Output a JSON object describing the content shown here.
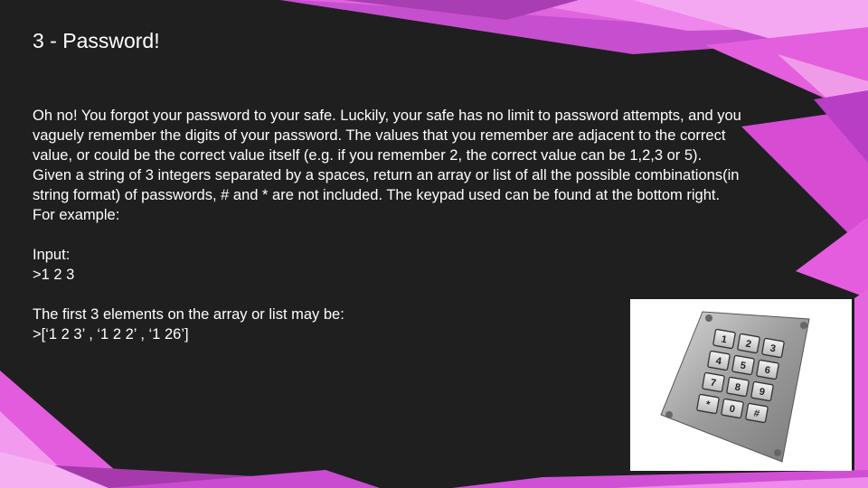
{
  "slide": {
    "title": "3 - Password!",
    "paragraphs": [
      "Oh no! You forgot your password to your safe. Luckily, your safe has no limit to password attempts, and you vaguely remember the digits of your password. The values that you remember are adjacent to the correct value, or could be the correct value itself (e.g. if you remember 2, the correct value can be 1,2,3 or 5).",
      "Given a string of 3 integers separated by a spaces, return an array or list of all the possible combinations(in string format) of passwords, # and * are not included. The keypad used can be found at the bottom right.",
      "For example:"
    ],
    "input_label": "Input:",
    "input_value": ">1 2 3",
    "output_label": "The first 3 elements on the array or list may be:",
    "output_value": ">[‘1 2 3’ , ‘1 2 2’ , ‘1 26’]"
  },
  "keypad": {
    "keys": [
      "1",
      "2",
      "3",
      "4",
      "5",
      "6",
      "7",
      "8",
      "9",
      "*",
      "0",
      "#"
    ]
  },
  "colors": {
    "background": "#1f1f1f",
    "accent_pink": "#e55be0",
    "accent_violet": "#c44ad8",
    "text": "#ffffff"
  }
}
